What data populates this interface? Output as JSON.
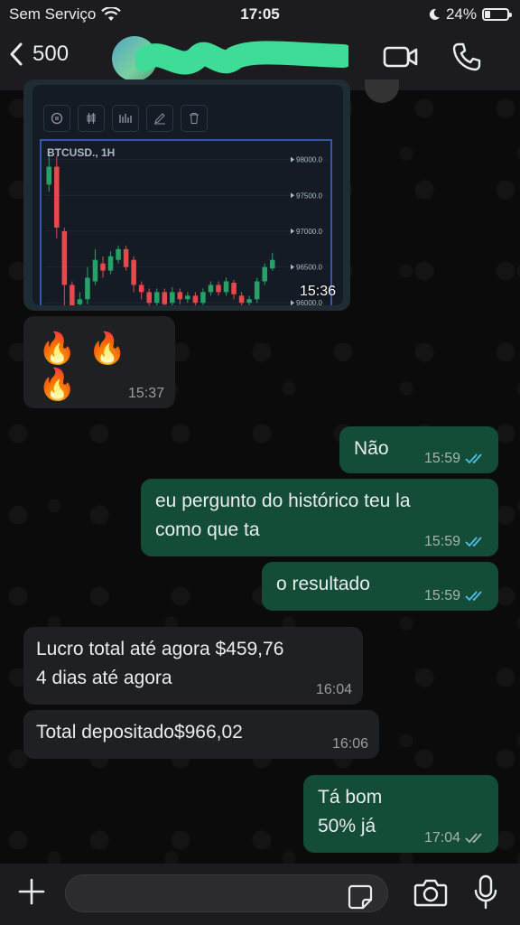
{
  "status_bar": {
    "carrier": "Sem Serviço",
    "time": "17:05",
    "battery_percent": "24%",
    "battery_level": 0.24,
    "icons": [
      "wifi-icon",
      "moon-icon",
      "battery-icon"
    ]
  },
  "header": {
    "unread_count": "500",
    "icons": [
      "back-chevron-icon",
      "video-call-icon",
      "phone-call-icon"
    ]
  },
  "chart_message": {
    "time": "15:36",
    "toolbar_icons": [
      "indicator-icon",
      "candle-icon",
      "bars-icon",
      "draw-icon",
      "trash-icon"
    ],
    "chart_data": {
      "type": "candlestick",
      "title": "BTCUSD., 1H",
      "yticks": [
        "98000.0",
        "97500.0",
        "97000.0",
        "96500.0",
        "96000.0"
      ],
      "ylim": [
        95940,
        98260
      ],
      "candles": [
        {
          "o": 97650,
          "c": 97900,
          "h": 98150,
          "l": 97550,
          "up": true
        },
        {
          "o": 97900,
          "c": 97050,
          "h": 98050,
          "l": 96900,
          "up": false
        },
        {
          "o": 97000,
          "c": 96250,
          "h": 97050,
          "l": 95940,
          "up": false
        },
        {
          "o": 96250,
          "c": 95950,
          "h": 96300,
          "l": 95940,
          "up": false
        },
        {
          "o": 95980,
          "c": 96050,
          "h": 96150,
          "l": 95940,
          "up": true
        },
        {
          "o": 96050,
          "c": 96350,
          "h": 96500,
          "l": 95980,
          "up": true
        },
        {
          "o": 96300,
          "c": 96600,
          "h": 96750,
          "l": 96250,
          "up": true
        },
        {
          "o": 96550,
          "c": 96450,
          "h": 96650,
          "l": 96350,
          "up": false
        },
        {
          "o": 96450,
          "c": 96650,
          "h": 96720,
          "l": 96400,
          "up": true
        },
        {
          "o": 96600,
          "c": 96750,
          "h": 96800,
          "l": 96550,
          "up": true
        },
        {
          "o": 96750,
          "c": 96500,
          "h": 96800,
          "l": 96450,
          "up": false
        },
        {
          "o": 96600,
          "c": 96250,
          "h": 96650,
          "l": 96150,
          "up": false
        },
        {
          "o": 96250,
          "c": 96150,
          "h": 96300,
          "l": 96050,
          "up": false
        },
        {
          "o": 96150,
          "c": 96000,
          "h": 96200,
          "l": 95950,
          "up": false
        },
        {
          "o": 96000,
          "c": 96150,
          "h": 96200,
          "l": 95950,
          "up": true
        },
        {
          "o": 96150,
          "c": 95980,
          "h": 96200,
          "l": 95950,
          "up": false
        },
        {
          "o": 96000,
          "c": 96150,
          "h": 96220,
          "l": 95960,
          "up": true
        },
        {
          "o": 96150,
          "c": 96050,
          "h": 96200,
          "l": 95980,
          "up": false
        },
        {
          "o": 96050,
          "c": 96100,
          "h": 96150,
          "l": 96000,
          "up": true
        },
        {
          "o": 96100,
          "c": 96000,
          "h": 96150,
          "l": 95950,
          "up": false
        },
        {
          "o": 96000,
          "c": 96150,
          "h": 96200,
          "l": 95970,
          "up": true
        },
        {
          "o": 96150,
          "c": 96250,
          "h": 96300,
          "l": 96100,
          "up": true
        },
        {
          "o": 96250,
          "c": 96150,
          "h": 96300,
          "l": 96100,
          "up": false
        },
        {
          "o": 96150,
          "c": 96300,
          "h": 96350,
          "l": 96100,
          "up": true
        },
        {
          "o": 96280,
          "c": 96120,
          "h": 96320,
          "l": 96050,
          "up": false
        },
        {
          "o": 96100,
          "c": 96000,
          "h": 96150,
          "l": 95950,
          "up": false
        },
        {
          "o": 96000,
          "c": 96050,
          "h": 96100,
          "l": 95950,
          "up": true
        },
        {
          "o": 96050,
          "c": 96300,
          "h": 96350,
          "l": 96000,
          "up": true
        },
        {
          "o": 96300,
          "c": 96500,
          "h": 96550,
          "l": 96250,
          "up": true
        },
        {
          "o": 96480,
          "c": 96600,
          "h": 96700,
          "l": 96450,
          "up": true
        }
      ]
    }
  },
  "messages": [
    {
      "id": "fire",
      "direction": "in",
      "text": "🔥 🔥 🔥",
      "time": "15:37"
    },
    {
      "id": "nao",
      "direction": "out",
      "text": "Não",
      "time": "15:59",
      "status": "read"
    },
    {
      "id": "pergunto",
      "direction": "out",
      "lines": [
        "eu pergunto do histórico teu la",
        "como que ta"
      ],
      "time": "15:59",
      "status": "read"
    },
    {
      "id": "resultado",
      "direction": "out",
      "text": "o resultado",
      "time": "15:59",
      "status": "read"
    },
    {
      "id": "lucro",
      "direction": "in",
      "lines": [
        "Lucro total até agora $459,76",
        "4 dias até agora"
      ],
      "time": "16:04"
    },
    {
      "id": "depositado",
      "direction": "in",
      "text": "Total depositado$966,02",
      "time": "16:06"
    },
    {
      "id": "tabom",
      "direction": "out",
      "lines": [
        "Tá bom",
        "50% já"
      ],
      "time": "17:04",
      "status": "delivered"
    }
  ],
  "colors": {
    "outgoing_bubble": "#134c37",
    "incoming_bubble": "#1f2022",
    "read_ticks": "#53bdeb",
    "delivered_ticks": "#a8b3ad",
    "candle_up": "#26a269",
    "candle_down": "#e5484d"
  },
  "input_bar": {
    "placeholder": "",
    "icons": [
      "plus-icon",
      "sticker-icon",
      "camera-icon",
      "microphone-icon"
    ]
  }
}
